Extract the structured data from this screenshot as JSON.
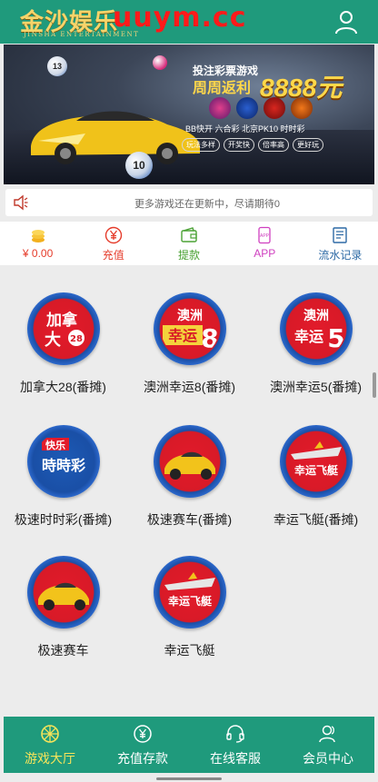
{
  "header": {
    "logo_cn": "金沙娱乐",
    "logo_en": "JINSHA ENTERTAINMENT",
    "watermark": "uuym.cc",
    "user_icon": "user-icon"
  },
  "banner": {
    "line1": "投注彩票游戏",
    "line2": "周周返利",
    "amount": "8888元",
    "lottos": "BB快开 六合彩 北京PK10 时时彩",
    "tags": [
      "玩法多样",
      "开奖快",
      "倍率高",
      "更好玩"
    ],
    "ball_13": "13",
    "ball_10": "10"
  },
  "notice": {
    "icon": "speaker-icon",
    "text": "更多游戏还在更新中，尽请期待0"
  },
  "quickbar": [
    {
      "label": "¥ 0.00",
      "icon": "coins-icon",
      "color": "#e53b2a"
    },
    {
      "label": "充值",
      "icon": "yen-circle-icon",
      "color": "#e53b2a"
    },
    {
      "label": "提款",
      "icon": "wallet-icon",
      "color": "#4aa234"
    },
    {
      "label": "APP",
      "icon": "app-icon",
      "color": "#cf3fbf"
    },
    {
      "label": "流水记录",
      "icon": "ledger-icon",
      "color": "#2d6aa5"
    }
  ],
  "games": [
    {
      "name": "加拿大28(番摊)",
      "logo": "加拿大28"
    },
    {
      "name": "澳洲幸运8(番摊)",
      "logo": "澳洲幸运8"
    },
    {
      "name": "澳洲幸运5(番摊)",
      "logo": "澳洲幸运5"
    },
    {
      "name": "极速时时彩(番摊)",
      "logo": "快乐時時彩"
    },
    {
      "name": "极速赛车(番摊)",
      "logo": "race-car"
    },
    {
      "name": "幸运飞艇(番摊)",
      "logo": "幸运飞艇"
    },
    {
      "name": "极速赛车",
      "logo": "race-car"
    },
    {
      "name": "幸运飞艇",
      "logo": "幸运飞艇"
    }
  ],
  "bottom_nav": [
    {
      "label": "游戏大厅",
      "icon": "wheel-icon",
      "active": true
    },
    {
      "label": "充值存款",
      "icon": "yen-circle-icon",
      "active": false
    },
    {
      "label": "在线客服",
      "icon": "headset-icon",
      "active": false
    },
    {
      "label": "会员中心",
      "icon": "members-icon",
      "active": false
    }
  ],
  "colors": {
    "brand": "#1f9a7c",
    "active_nav": "#f7e45a",
    "game_red": "#d81a27",
    "game_blue": "#1a4fa6"
  }
}
